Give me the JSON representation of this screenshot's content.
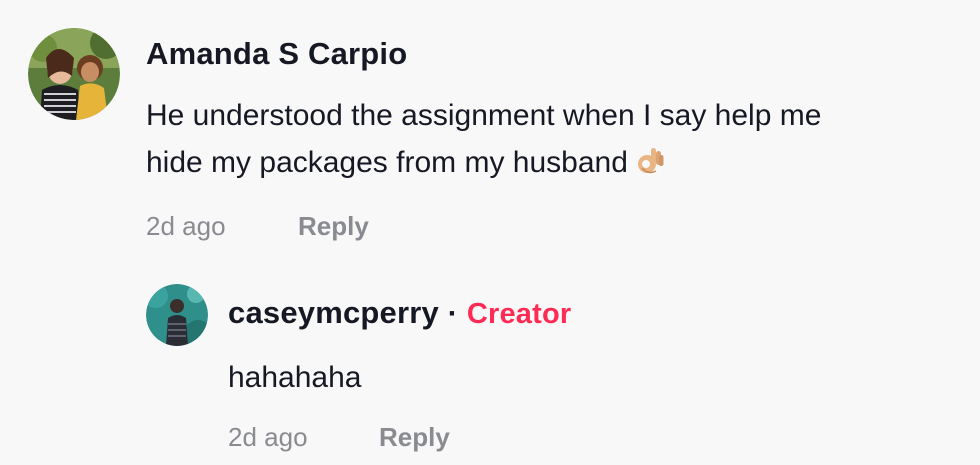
{
  "comment": {
    "author": "Amanda S Carpio",
    "line1": "He understood the assignment when I say help me",
    "line2": "hide my packages from my husband",
    "emoji": "ok-hand-emoji",
    "time": "2d ago",
    "reply_label": "Reply"
  },
  "reply": {
    "author": "caseymcperry",
    "separator": "·",
    "badge": "Creator",
    "text": "hahahaha",
    "time": "2d ago",
    "reply_label": "Reply"
  },
  "colors": {
    "background": "#f8f8f8",
    "text": "#161823",
    "muted": "#8a8b91",
    "creator": "#fe2c55"
  }
}
